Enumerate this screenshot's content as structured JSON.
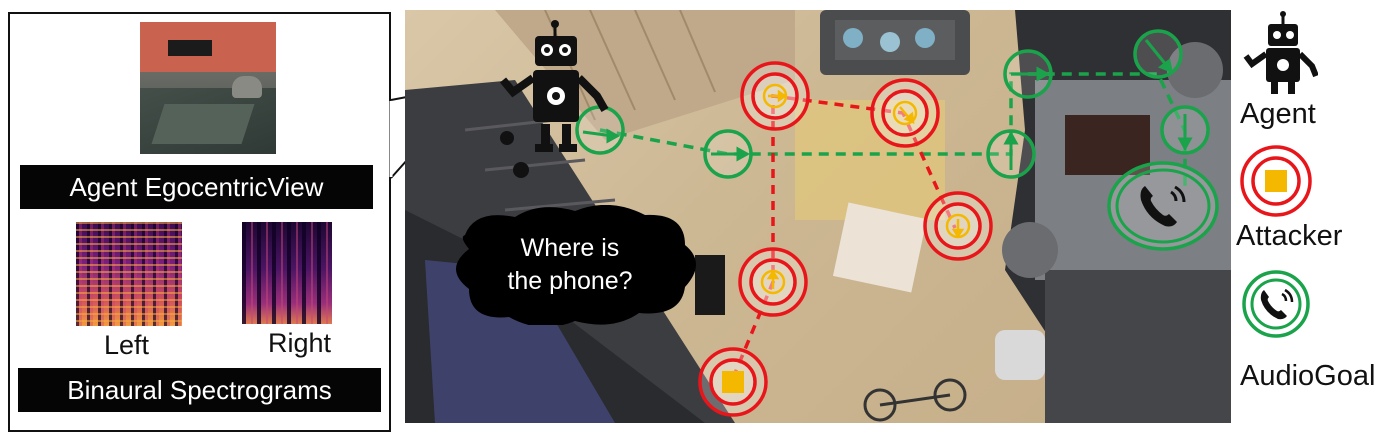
{
  "left_panel": {
    "ego_label": "Agent EgocentricView",
    "spectrogram_left_label": "Left",
    "spectrogram_right_label": "Right",
    "binaural_label": "Binaural Spectrograms"
  },
  "scene": {
    "speech_bubble": "Where is\nthe phone?"
  },
  "legend": {
    "agent_label": "Agent",
    "attacker_label": "Attacker",
    "goal_label": "AudioGoal"
  },
  "colors": {
    "attacker": "#e8161b",
    "goal": "#1aa34a",
    "arrow_fill": "#f5b800"
  }
}
